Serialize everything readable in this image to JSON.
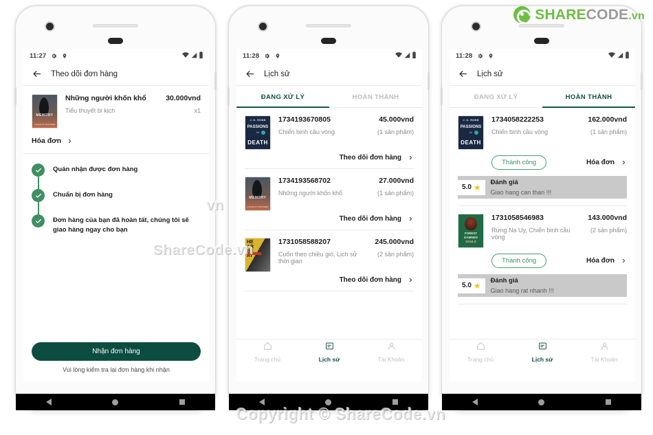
{
  "brand": {
    "logo_share": "SHARE",
    "logo_code": "CODE",
    "logo_tld": ".vn",
    "watermark_mid": "ShareCode.vn",
    "watermark_side": "vn",
    "watermark_bottom": "Copyright © ShareCode.vn",
    "accent_green": "#6fbe44",
    "primary_dark": "#0d4d40",
    "status_green": "#3f8f63",
    "star_yellow": "#f5c518"
  },
  "phone1": {
    "status": {
      "time": "11:27",
      "icons": [
        "gear-icon",
        "location-pin-icon"
      ],
      "right_icons": [
        "wifi-icon",
        "signal-icon",
        "battery-icon"
      ]
    },
    "appbar": {
      "back": "back-arrow-icon",
      "title": "Theo dõi đơn hàng"
    },
    "order": {
      "cover": "memory-book-cover",
      "title": "Những người khốn khổ",
      "subtitle": "Tiểu thuyết bi kịch",
      "price": "30.000vnd",
      "qty": "x1"
    },
    "invoice_label": "Hóa đơn",
    "timeline": [
      {
        "text": "Quán nhận được đơn hàng"
      },
      {
        "text": "Chuẩn bị đơn hàng"
      },
      {
        "text": "Đơn hàng của bạn đã hoàn tất, chúng tôi sẽ giao hàng ngay cho bạn"
      }
    ],
    "primary_button": "Nhận đơn hàng",
    "footer_note": "Vui lòng kiểm tra lại đơn hàng khi nhận"
  },
  "phone2": {
    "status": {
      "time": "11:28"
    },
    "appbar": {
      "title": "Lịch sử"
    },
    "tabs": [
      {
        "label": "ĐANG XỬ LÝ",
        "active": true
      },
      {
        "label": "HOÀN THÀNH",
        "active": false
      }
    ],
    "track_label": "Theo dõi đơn hàng",
    "orders": [
      {
        "cover": "passions-in-death-cover",
        "code": "1734193670805",
        "items": "Chiến binh cầu vòng",
        "price": "45.000vnd",
        "qty": "(1 sản phẩm)"
      },
      {
        "cover": "memory-book-cover",
        "code": "1734193568702",
        "items": "Những người khốn khổ",
        "price": "27.000vnd",
        "qty": "(1 sản phẩm)"
      },
      {
        "cover": "heartbeat-book-cover",
        "code": "1731058588207",
        "items": "Cuốn theo chiều gió, Lịch sử thời gian",
        "price": "245.000vnd",
        "qty": "(2 sản phẩm)"
      }
    ],
    "bottomnav": [
      {
        "icon": "home-icon",
        "label": "Trang chủ",
        "active": false
      },
      {
        "icon": "receipt-icon",
        "label": "Lịch sử",
        "active": true
      },
      {
        "icon": "person-icon",
        "label": "Tài Khoản",
        "active": false
      }
    ]
  },
  "phone3": {
    "status": {
      "time": "11:28"
    },
    "appbar": {
      "title": "Lịch sử"
    },
    "tabs": [
      {
        "label": "ĐANG XỬ LÝ",
        "active": false
      },
      {
        "label": "HOÀN THÀNH",
        "active": true
      }
    ],
    "invoice_label": "Hóa đơn",
    "orders": [
      {
        "cover": "passions-in-death-cover",
        "code": "1734058222253",
        "items": "Chiến binh cầu vòng",
        "price": "162.000vnd",
        "qty": "(1 sản phẩm)",
        "badge": "Thành công",
        "rating_score": "5.0",
        "rating_title": "Đánh giá",
        "rating_comment": "Giao hang can than !!!"
      },
      {
        "cover": "forest-damned-souls-cover",
        "code": "1731058546983",
        "items": "Rừng Na Uy, Chiến binh cầu vòng",
        "price": "143.000vnd",
        "qty": "(2 sản phẩm)",
        "badge": "Thành công",
        "rating_score": "5.0",
        "rating_title": "Đánh giá",
        "rating_comment": "Giao hang rat nhanh !!!"
      }
    ],
    "bottomnav": [
      {
        "icon": "home-icon",
        "label": "Trang chủ",
        "active": false
      },
      {
        "icon": "receipt-icon",
        "label": "Lịch sử",
        "active": true
      },
      {
        "icon": "person-icon",
        "label": "Tài Khoản",
        "active": false
      }
    ]
  },
  "covers": {
    "memory": {
      "title": "MEMORY",
      "byline": "A NOVEL BY MAYA REED"
    },
    "death": {
      "author": "J. D. ROBB",
      "line1": "PASSIONS",
      "line2": "IN",
      "line3": "DEATH"
    },
    "heart": {
      "letters": "HE\nAR\nBE\nAT"
    },
    "forest": {
      "t1": "FOREST",
      "t2": "DAMNED",
      "t3": "SOULS"
    }
  }
}
